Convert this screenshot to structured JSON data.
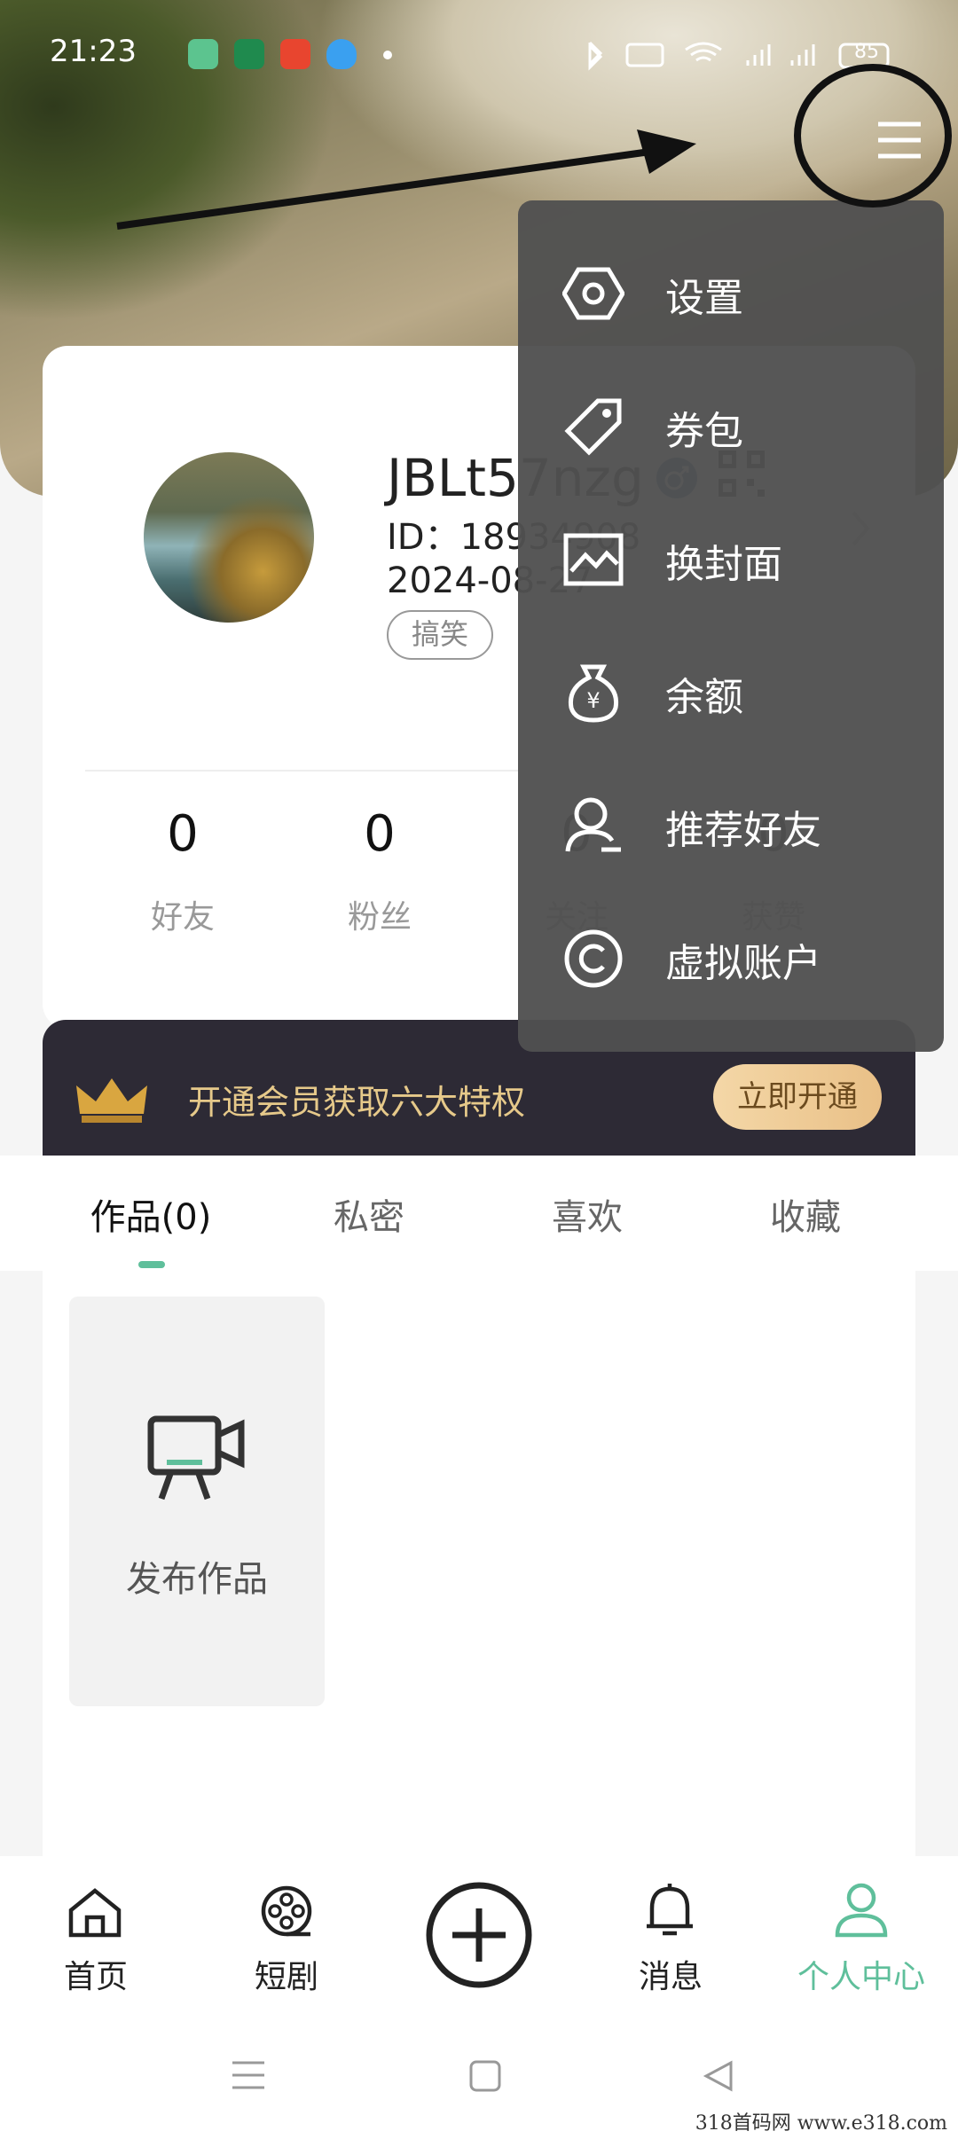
{
  "status_bar": {
    "time": "21:23",
    "battery": "85"
  },
  "profile": {
    "username": "JBLt57nzg",
    "id_label": "ID：",
    "id_value": "18934908",
    "date": "2024-08-27",
    "tag": "搞笑",
    "gender_icon": "male-icon"
  },
  "stats": [
    {
      "value": "0",
      "label": "好友"
    },
    {
      "value": "0",
      "label": "粉丝"
    },
    {
      "value": "0",
      "label": "关注"
    },
    {
      "value": "0",
      "label": "获赞"
    }
  ],
  "vip": {
    "text": "开通会员获取六大特权",
    "button": "立即开通"
  },
  "tabs": [
    {
      "label": "作品(0)"
    },
    {
      "label": "私密"
    },
    {
      "label": "喜欢"
    },
    {
      "label": "收藏"
    }
  ],
  "content": {
    "publish_label": "发布作品"
  },
  "menu": {
    "items": [
      {
        "label": "设置",
        "icon": "hexagon-settings-icon"
      },
      {
        "label": "券包",
        "icon": "coupon-tag-icon"
      },
      {
        "label": "换封面",
        "icon": "image-cover-icon"
      },
      {
        "label": "余额",
        "icon": "money-bag-icon"
      },
      {
        "label": "推荐好友",
        "icon": "recommend-friend-icon"
      },
      {
        "label": "虚拟账户",
        "icon": "virtual-account-icon"
      }
    ]
  },
  "nav": {
    "items": [
      {
        "label": "首页",
        "icon": "home-icon"
      },
      {
        "label": "短剧",
        "icon": "film-reel-icon"
      },
      {
        "label": "",
        "icon": "plus-circle-icon"
      },
      {
        "label": "消息",
        "icon": "bell-icon"
      },
      {
        "label": "个人中心",
        "icon": "person-icon"
      }
    ]
  },
  "watermark": "318首码网  www.e318.com",
  "colors": {
    "accent": "#5fbf9b",
    "vip_gold": "#e6c98a",
    "menu_bg": "#505050"
  }
}
